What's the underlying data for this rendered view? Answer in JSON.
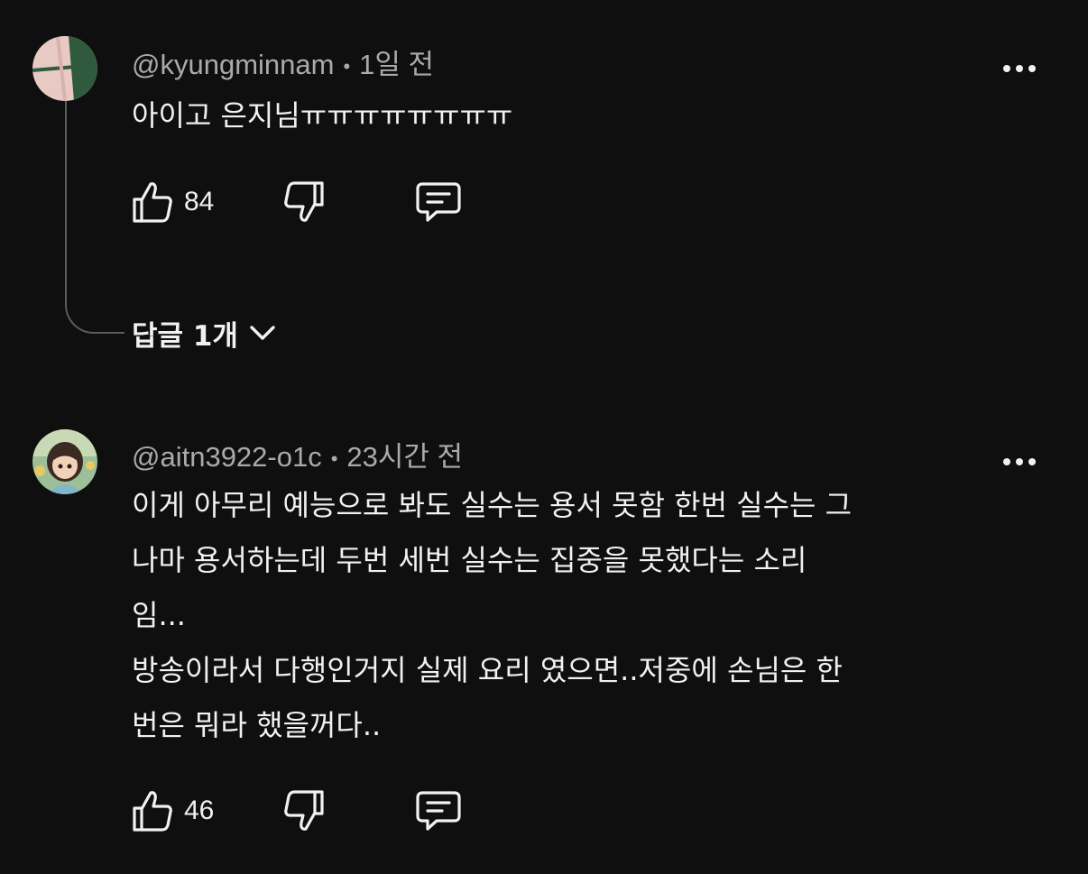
{
  "comments": [
    {
      "author": "@kyungminnam",
      "time": "1일 전",
      "text": "아이고 은지님ㅠㅠㅠㅠㅠㅠㅠㅠ",
      "likes": "84",
      "replies_label": "답글 1개"
    },
    {
      "author": "@aitn3922-o1c",
      "time": "23시간 전",
      "text": "이게 아무리 예능으로 봐도 실수는 용서 못함 한번 실수는 그\n나마 용서하는데 두번 세번 실수는 집중을 못했다는 소리\n임...\n방송이라서 다행인거지 실제 요리 였으면..저중에 손님은 한\n번은 뭐라 했을꺼다..",
      "likes": "46"
    }
  ],
  "separator": "•",
  "icons": [
    "like-icon",
    "dislike-icon",
    "reply-icon",
    "more-icon",
    "chevron-down-icon"
  ]
}
